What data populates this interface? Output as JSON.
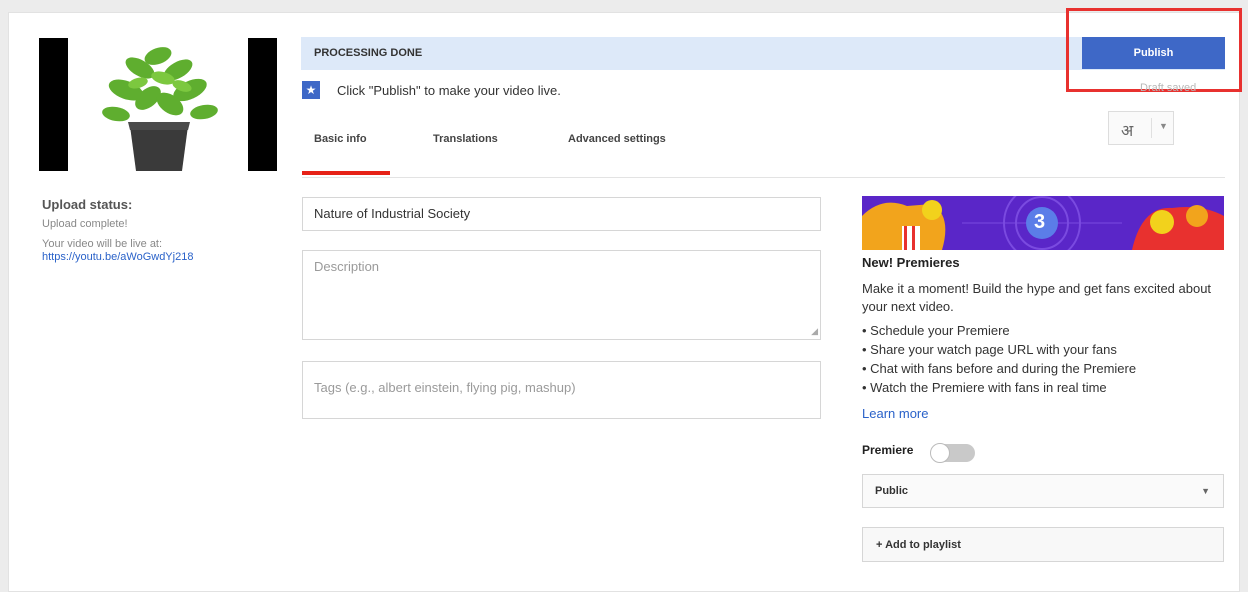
{
  "processing": {
    "label": "PROCESSING DONE"
  },
  "publish": {
    "label": "Publish",
    "saved_label": "Draft saved"
  },
  "message": {
    "text": "Click \"Publish\" to make your video live."
  },
  "language": {
    "glyph": "अ"
  },
  "tabs": [
    {
      "label": "Basic info",
      "active": true
    },
    {
      "label": "Translations",
      "active": false
    },
    {
      "label": "Advanced settings",
      "active": false
    }
  ],
  "upload": {
    "title": "Upload status:",
    "status": "Upload complete!",
    "live_label": "Your video will be live at:",
    "live_url": "https://youtu.be/aWoGwdYj218"
  },
  "form": {
    "title_value": "Nature of Industrial Society",
    "description_placeholder": "Description",
    "tags_placeholder": "Tags (e.g., albert einstein, flying pig, mashup)"
  },
  "premieres": {
    "banner_number": "3",
    "title": "New! Premieres",
    "description": "Make it a moment! Build the hype and get fans excited about your next video.",
    "bullets": [
      "Schedule your Premiere",
      "Share your watch page URL with your fans",
      "Chat with fans before and during the Premiere",
      "Watch the Premiere with fans in real time"
    ],
    "learn_more": "Learn more",
    "toggle_label": "Premiere",
    "toggle_on": false
  },
  "visibility": {
    "selected": "Public"
  },
  "playlist": {
    "label": "+ Add to playlist"
  },
  "colors": {
    "accent": "#3e68c7",
    "tab_active": "#e62117",
    "highlight": "#e8312f",
    "banner": "#5a26c8",
    "processing_bg": "#dde9f9"
  }
}
